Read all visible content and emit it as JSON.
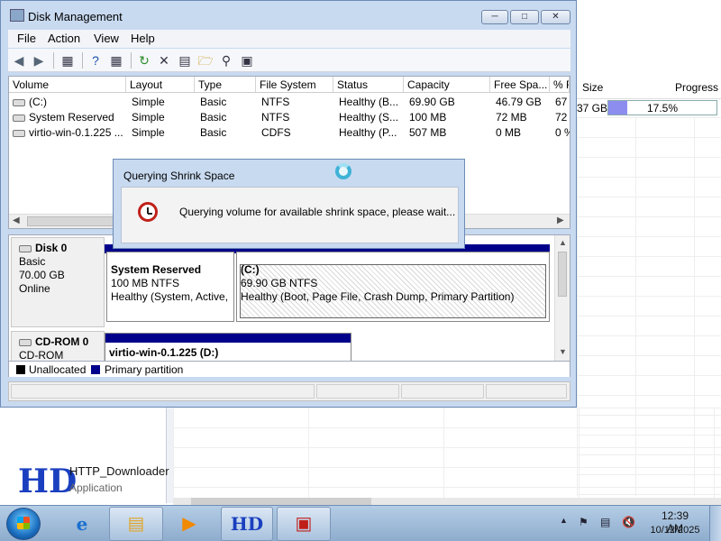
{
  "background_app": {
    "columns": {
      "size": "Size",
      "progress": "Progress"
    },
    "row": {
      "size": "37 GB",
      "progress_text": "17.5%",
      "progress_fraction": 0.175
    },
    "app_name": "HTTP_Downloader",
    "app_type": "Application",
    "logo_text": "HD"
  },
  "disk_management": {
    "title": "Disk Management",
    "menu": [
      "File",
      "Action",
      "View",
      "Help"
    ],
    "columns": [
      "Volume",
      "Layout",
      "Type",
      "File System",
      "Status",
      "Capacity",
      "Free Spa...",
      "% F"
    ],
    "volumes": [
      {
        "volume": "(C:)",
        "layout": "Simple",
        "type": "Basic",
        "fs": "NTFS",
        "status": "Healthy (B...",
        "capacity": "69.90 GB",
        "free": "46.79 GB",
        "pct": "67"
      },
      {
        "volume": "System Reserved",
        "layout": "Simple",
        "type": "Basic",
        "fs": "NTFS",
        "status": "Healthy (S...",
        "capacity": "100 MB",
        "free": "72 MB",
        "pct": "72"
      },
      {
        "volume": "virtio-win-0.1.225 ...",
        "layout": "Simple",
        "type": "Basic",
        "fs": "CDFS",
        "status": "Healthy (P...",
        "capacity": "507 MB",
        "free": "0 MB",
        "pct": "0 %"
      }
    ],
    "disks": [
      {
        "name": "Disk 0",
        "type": "Basic",
        "size": "70.00 GB",
        "state": "Online",
        "partitions": [
          {
            "name": "System Reserved",
            "size_fs": "100 MB NTFS",
            "status": "Healthy (System, Active,"
          },
          {
            "name": "(C:)",
            "size_fs": "69.90 GB NTFS",
            "status": "Healthy (Boot, Page File, Crash Dump, Primary Partition)"
          }
        ]
      },
      {
        "name": "CD-ROM 0",
        "type": "CD-ROM",
        "partitions": [
          {
            "name": "virtio-win-0.1.225  (D:)"
          }
        ]
      }
    ],
    "legend": [
      {
        "label": "Unallocated",
        "color": "#000000"
      },
      {
        "label": "Primary partition",
        "color": "#00008b"
      }
    ]
  },
  "dialog": {
    "title": "Querying Shrink Space",
    "message": "Querying volume for available shrink space, please wait..."
  },
  "taskbar": {
    "time": "12:39 AM",
    "date": "10/12/2025",
    "icons": [
      "start-orb",
      "internet-explorer-icon",
      "file-explorer-icon",
      "media-player-icon",
      "http-downloader-icon",
      "computer-management-icon"
    ]
  }
}
